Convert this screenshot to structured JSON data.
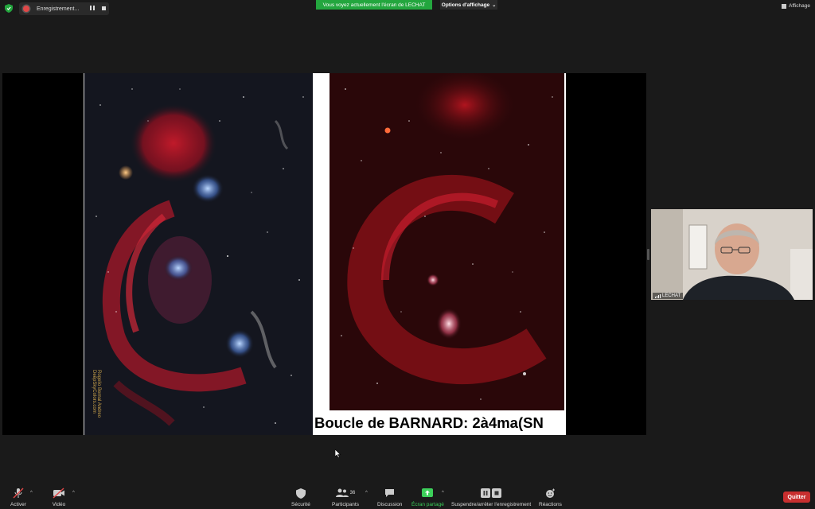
{
  "recording": {
    "label": "Enregistrement..."
  },
  "share_banner": {
    "text": "Vous voyez actuellement l'écran de LECHAT"
  },
  "view_options": {
    "label": "Options d'affichage"
  },
  "view_button": {
    "label": "Affichage"
  },
  "slide": {
    "credit_line1": "Rogelio Bernal Andreo",
    "credit_line2": "DeepSkyColors.com",
    "caption": "Boucle de BARNARD: 2à4ma(SN"
  },
  "participant_video": {
    "name": "LECHAT"
  },
  "toolbar": {
    "unmute_label": "Activer",
    "video_label": "Vidéo",
    "security_label": "Sécurité",
    "participants_label": "Participants",
    "participants_count": "36",
    "chat_label": "Discussion",
    "share_label": "Écran partagé",
    "record_label": "Suspendre/arrêter l'enregistrement",
    "reactions_label": "Réactions",
    "quit_label": "Quitter"
  },
  "colors": {
    "background": "#1a1a1a",
    "share_banner": "#23a63e",
    "quit_button": "#c82f2f",
    "share_active": "#3ccf5a"
  },
  "icons": [
    "shield-icon",
    "record-dot-icon",
    "pause-icon",
    "stop-icon",
    "grid-icon",
    "mic-muted-icon",
    "camera-off-icon",
    "security-icon",
    "participants-icon",
    "chat-icon",
    "share-screen-icon",
    "pause-record-icon",
    "stop-record-icon",
    "reactions-icon",
    "signal-icon",
    "chevron-up-icon"
  ]
}
